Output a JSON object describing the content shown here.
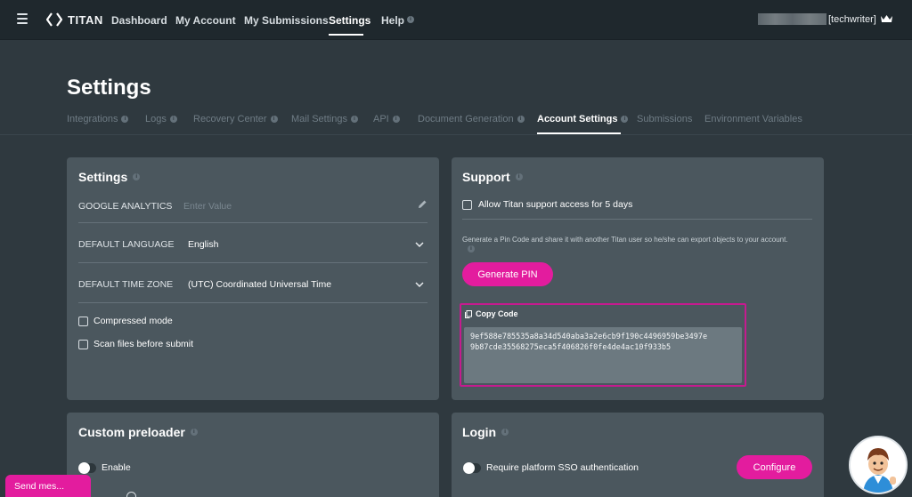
{
  "nav": {
    "brand": "TITAN",
    "links": [
      "Dashboard",
      "My Account",
      "My Submissions",
      "Settings",
      "Help"
    ],
    "user": "[techwriter]"
  },
  "page": {
    "title": "Settings",
    "tabs": [
      "Integrations",
      "Logs",
      "Recovery Center",
      "Mail Settings",
      "API",
      "Document Generation",
      "Account Settings",
      "Submissions",
      "Environment Variables"
    ]
  },
  "settings_card": {
    "title": "Settings",
    "google_analytics_label": "GOOGLE ANALYTICS",
    "google_analytics_placeholder": "Enter Value",
    "default_language_label": "DEFAULT LANGUAGE",
    "default_language_value": "English",
    "time_zone_label": "DEFAULT TIME ZONE",
    "time_zone_value": "(UTC) Coordinated Universal Time",
    "compressed_mode": "Compressed mode",
    "scan_files": "Scan files before submit"
  },
  "support_card": {
    "title": "Support",
    "allow_access": "Allow Titan support access for 5 days",
    "helper": "Generate a Pin Code and share it with another Titan user so he/she can export objects to your account.",
    "generate_pin": "Generate PIN",
    "copy_code": "Copy Code",
    "code_line1": "9ef588e785535a8a34d540aba3a2e6cb9f190c4496959be3497e",
    "code_line2": "9b87cde35568275eca5f406826f0fe4de4ac10f933b5"
  },
  "preloader_card": {
    "title": "Custom preloader",
    "enable": "Enable"
  },
  "login_card": {
    "title": "Login",
    "require_sso": "Require platform SSO authentication",
    "configure": "Configure"
  },
  "chat": {
    "send_message": "Send mes..."
  },
  "colors": {
    "accent": "#e31c9e",
    "background": "#2f393f",
    "card": "#4b575e",
    "topbar": "#1f282d"
  }
}
